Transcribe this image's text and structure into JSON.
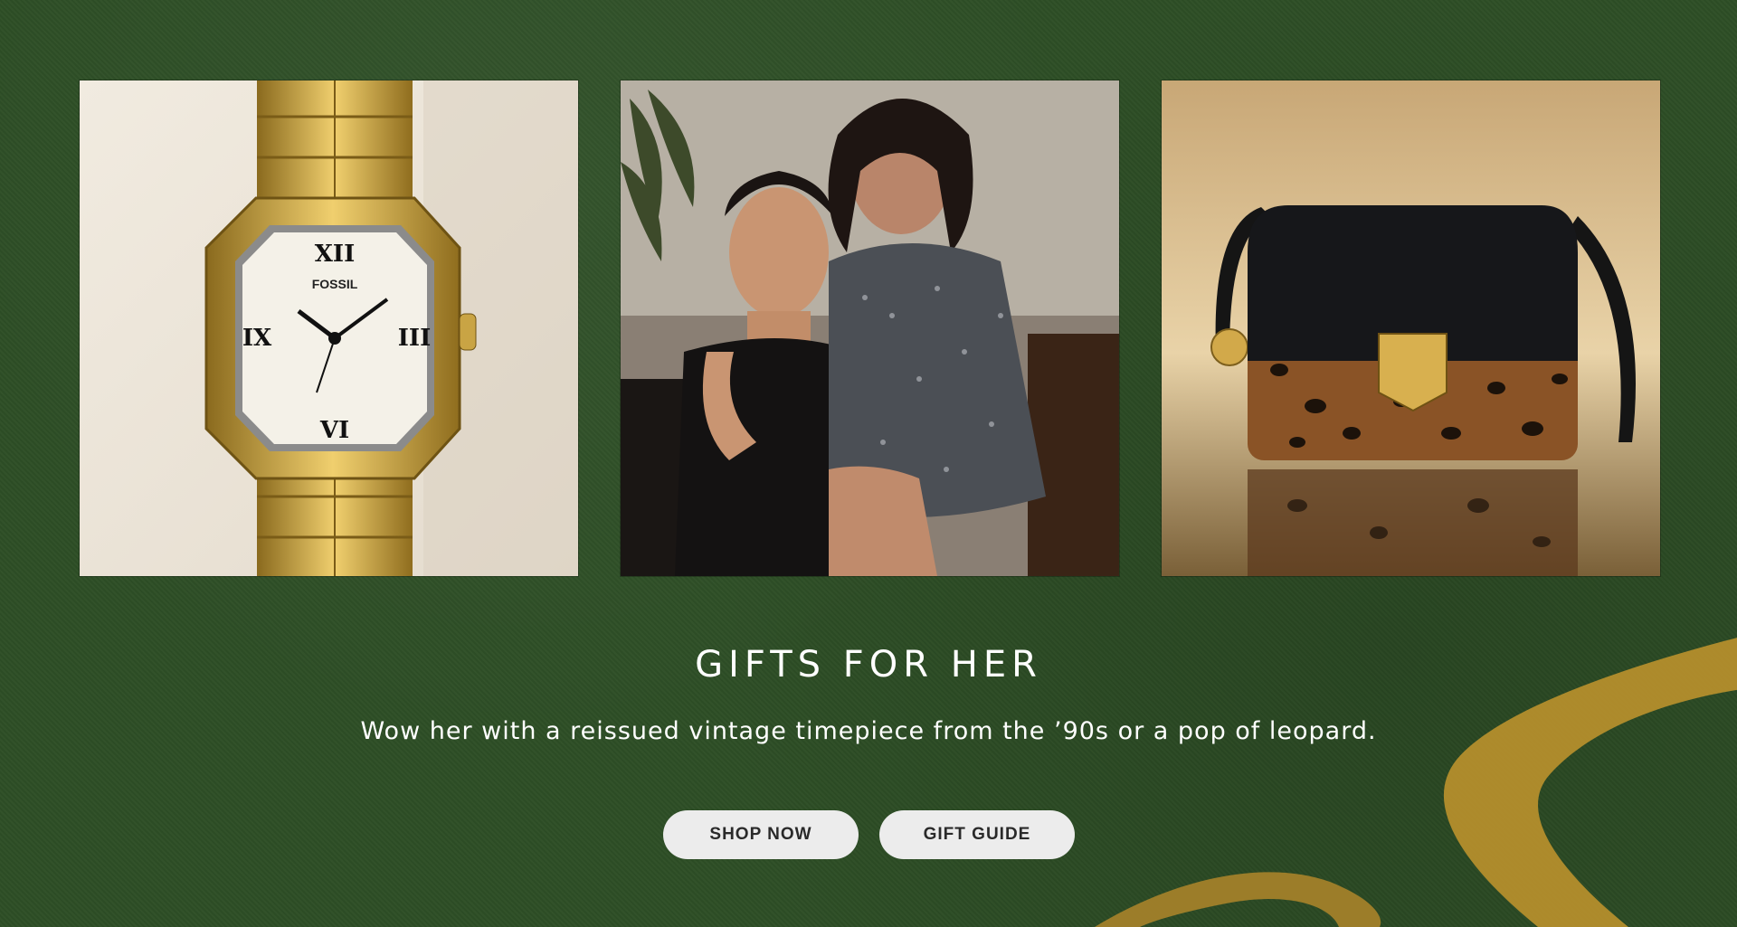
{
  "hero": {
    "headline": "GIFTS FOR HER",
    "subline": "Wow her with a reissued vintage timepiece from the ’90s or a pop of leopard.",
    "buttons": {
      "shop_now": "SHOP NOW",
      "gift_guide": "GIFT GUIDE"
    }
  },
  "images": {
    "watch": {
      "brand_on_dial": "FOSSIL"
    },
    "models": {},
    "bag": {}
  },
  "colors": {
    "background": "#2e4f26",
    "accent_gold": "#b8902d",
    "button_bg": "#ececec",
    "button_text": "#2a2a2a",
    "text": "#ffffff"
  }
}
